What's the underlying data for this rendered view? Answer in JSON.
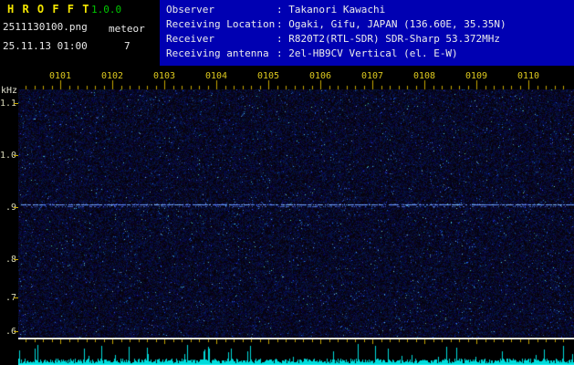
{
  "header": {
    "app_title": "H R O F F T",
    "version": "1.0.0",
    "filename": "2511130100.png",
    "mode_label": "meteor",
    "datetime": "25.11.13 01:00",
    "count": "7",
    "separator": ":",
    "info_rows": [
      {
        "label": "Observer",
        "value": "Takanori Kawachi"
      },
      {
        "label": "Receiving Location",
        "value": "Ogaki, Gifu, JAPAN (136.60E, 35.35N)"
      },
      {
        "label": "Receiver",
        "value": "R820T2(RTL-SDR) SDR-Sharp 53.372MHz"
      },
      {
        "label": "Receiving antenna",
        "value": "2el-HB9CV Vertical (el. E-W)"
      }
    ]
  },
  "axes": {
    "y_unit": "kHz",
    "y_tick_labels": [
      "1.1",
      "1.0",
      ".9",
      ".8",
      ".7",
      ".6"
    ],
    "x_tick_labels": [
      "0101",
      "0102",
      "0103",
      "0104",
      "0105",
      "0106",
      "0107",
      "0108",
      "0109",
      "0110"
    ]
  },
  "spectrogram": {
    "carrier_line_khz": 0.91,
    "colors": {
      "header_bg": "#0000b2",
      "title": "#f4e600",
      "version": "#00c800",
      "header_text": "#ececec",
      "axis_label": "#d8d8b8",
      "time_label": "#dcc81e",
      "tick": "#c8a800",
      "carrier": "#9cc8ff",
      "baseline_line": "#e2e2d8",
      "amplitude": "#00dcdc"
    }
  }
}
